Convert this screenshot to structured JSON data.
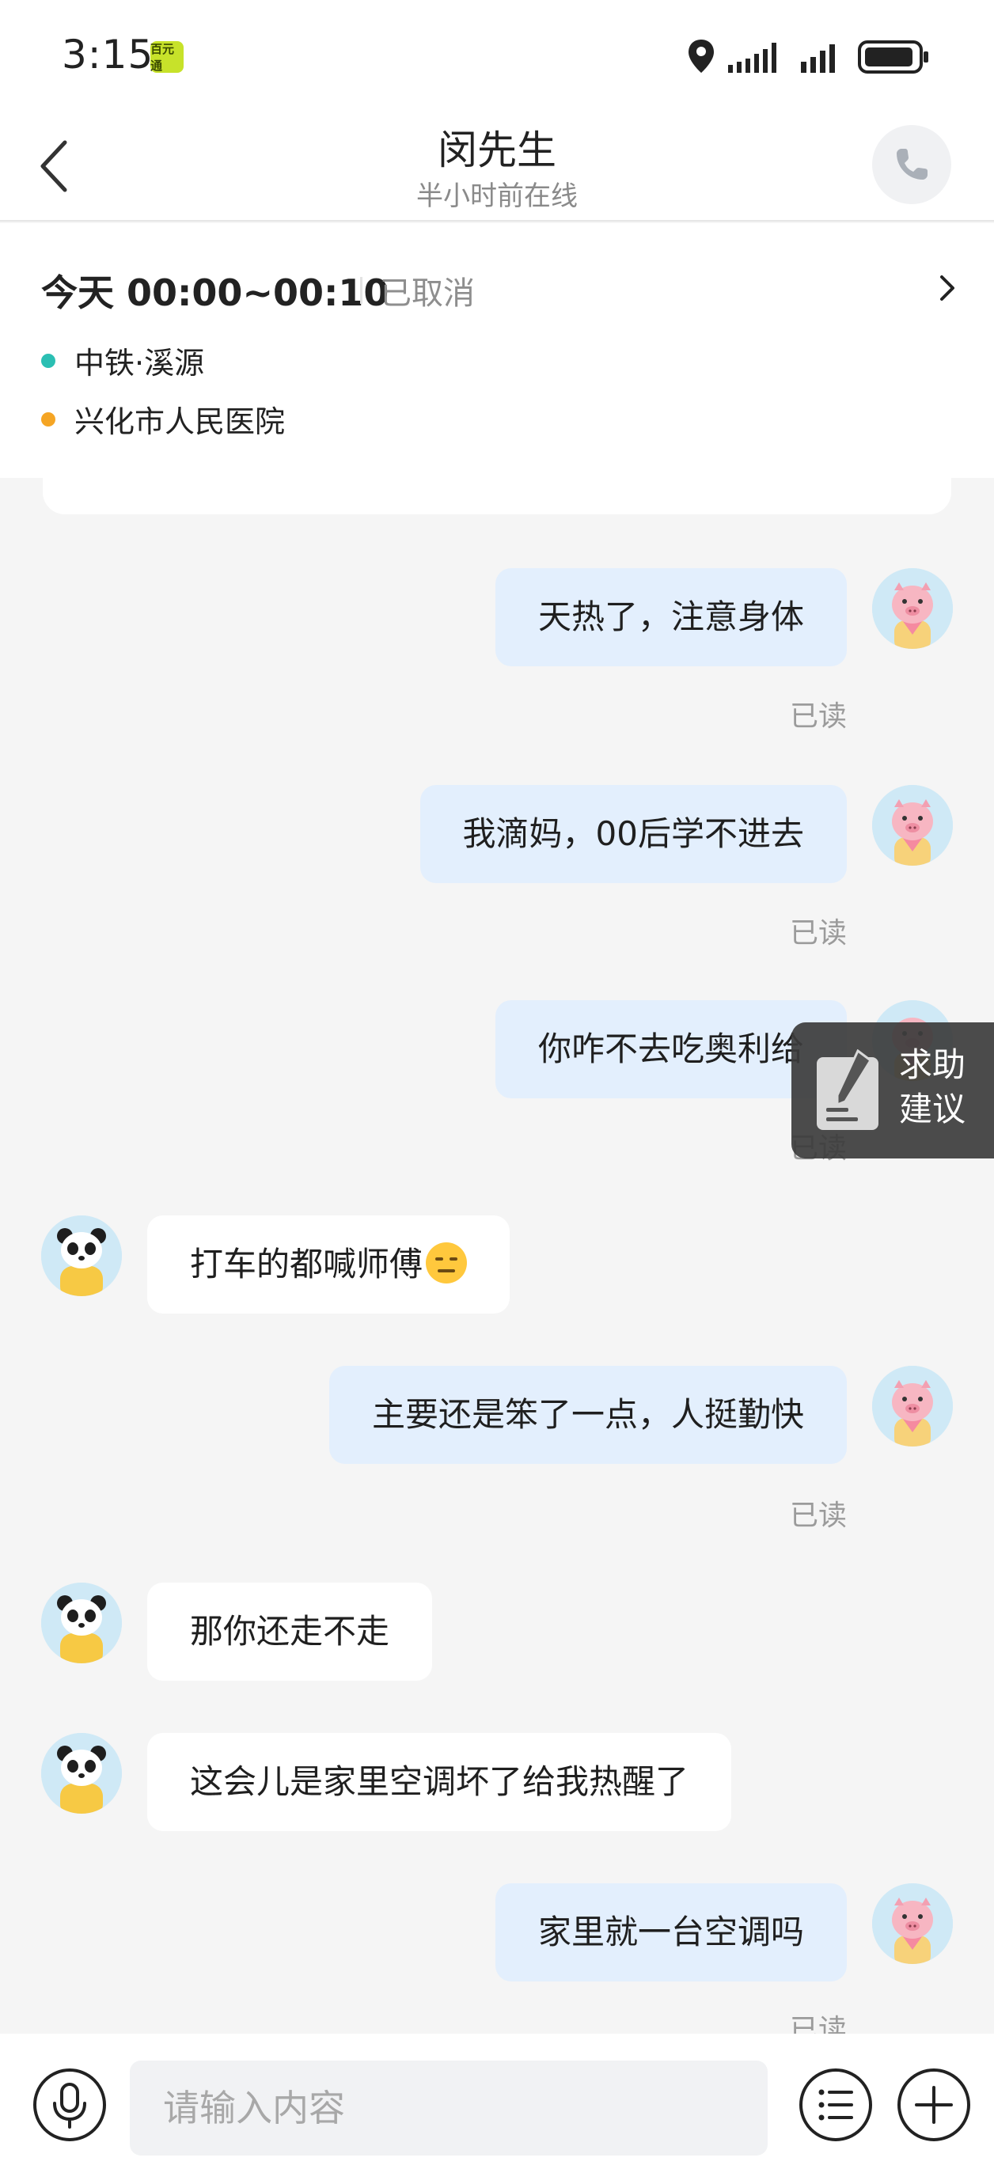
{
  "status_bar": {
    "time": "3:15",
    "app_badge": "百元通"
  },
  "header": {
    "contact_name": "闵先生",
    "online_status": "半小时前在线"
  },
  "trip": {
    "time": "今天 00:00~00:10",
    "status": "已取消",
    "start": "中铁·溪源",
    "end": "兴化市人民医院",
    "start_color": "#2bbfb3",
    "end_color": "#f5a524"
  },
  "messages": [
    {
      "sender": "self",
      "text": "天热了，注意身体",
      "read": "已读"
    },
    {
      "sender": "self",
      "text": "我滴妈，00后学不进去",
      "read": "已读"
    },
    {
      "sender": "self",
      "text": "你咋不去吃奥利给",
      "read": "已读"
    },
    {
      "sender": "other",
      "text": "打车的都喊师傅",
      "emoji": "expressionless-face"
    },
    {
      "sender": "self",
      "text": "主要还是笨了一点，人挺勤快",
      "read": "已读"
    },
    {
      "sender": "other",
      "text": "那你还走不走"
    },
    {
      "sender": "other",
      "text": "这会儿是家里空调坏了给我热醒了"
    },
    {
      "sender": "self",
      "text": "家里就一台空调吗",
      "read": "已读"
    }
  ],
  "help_overlay": {
    "label": "求助建议"
  },
  "input_bar": {
    "placeholder": "请输入内容"
  },
  "colors": {
    "outgoing_bubble": "#e3effd",
    "incoming_bubble": "#ffffff",
    "background": "#f5f5f5"
  }
}
